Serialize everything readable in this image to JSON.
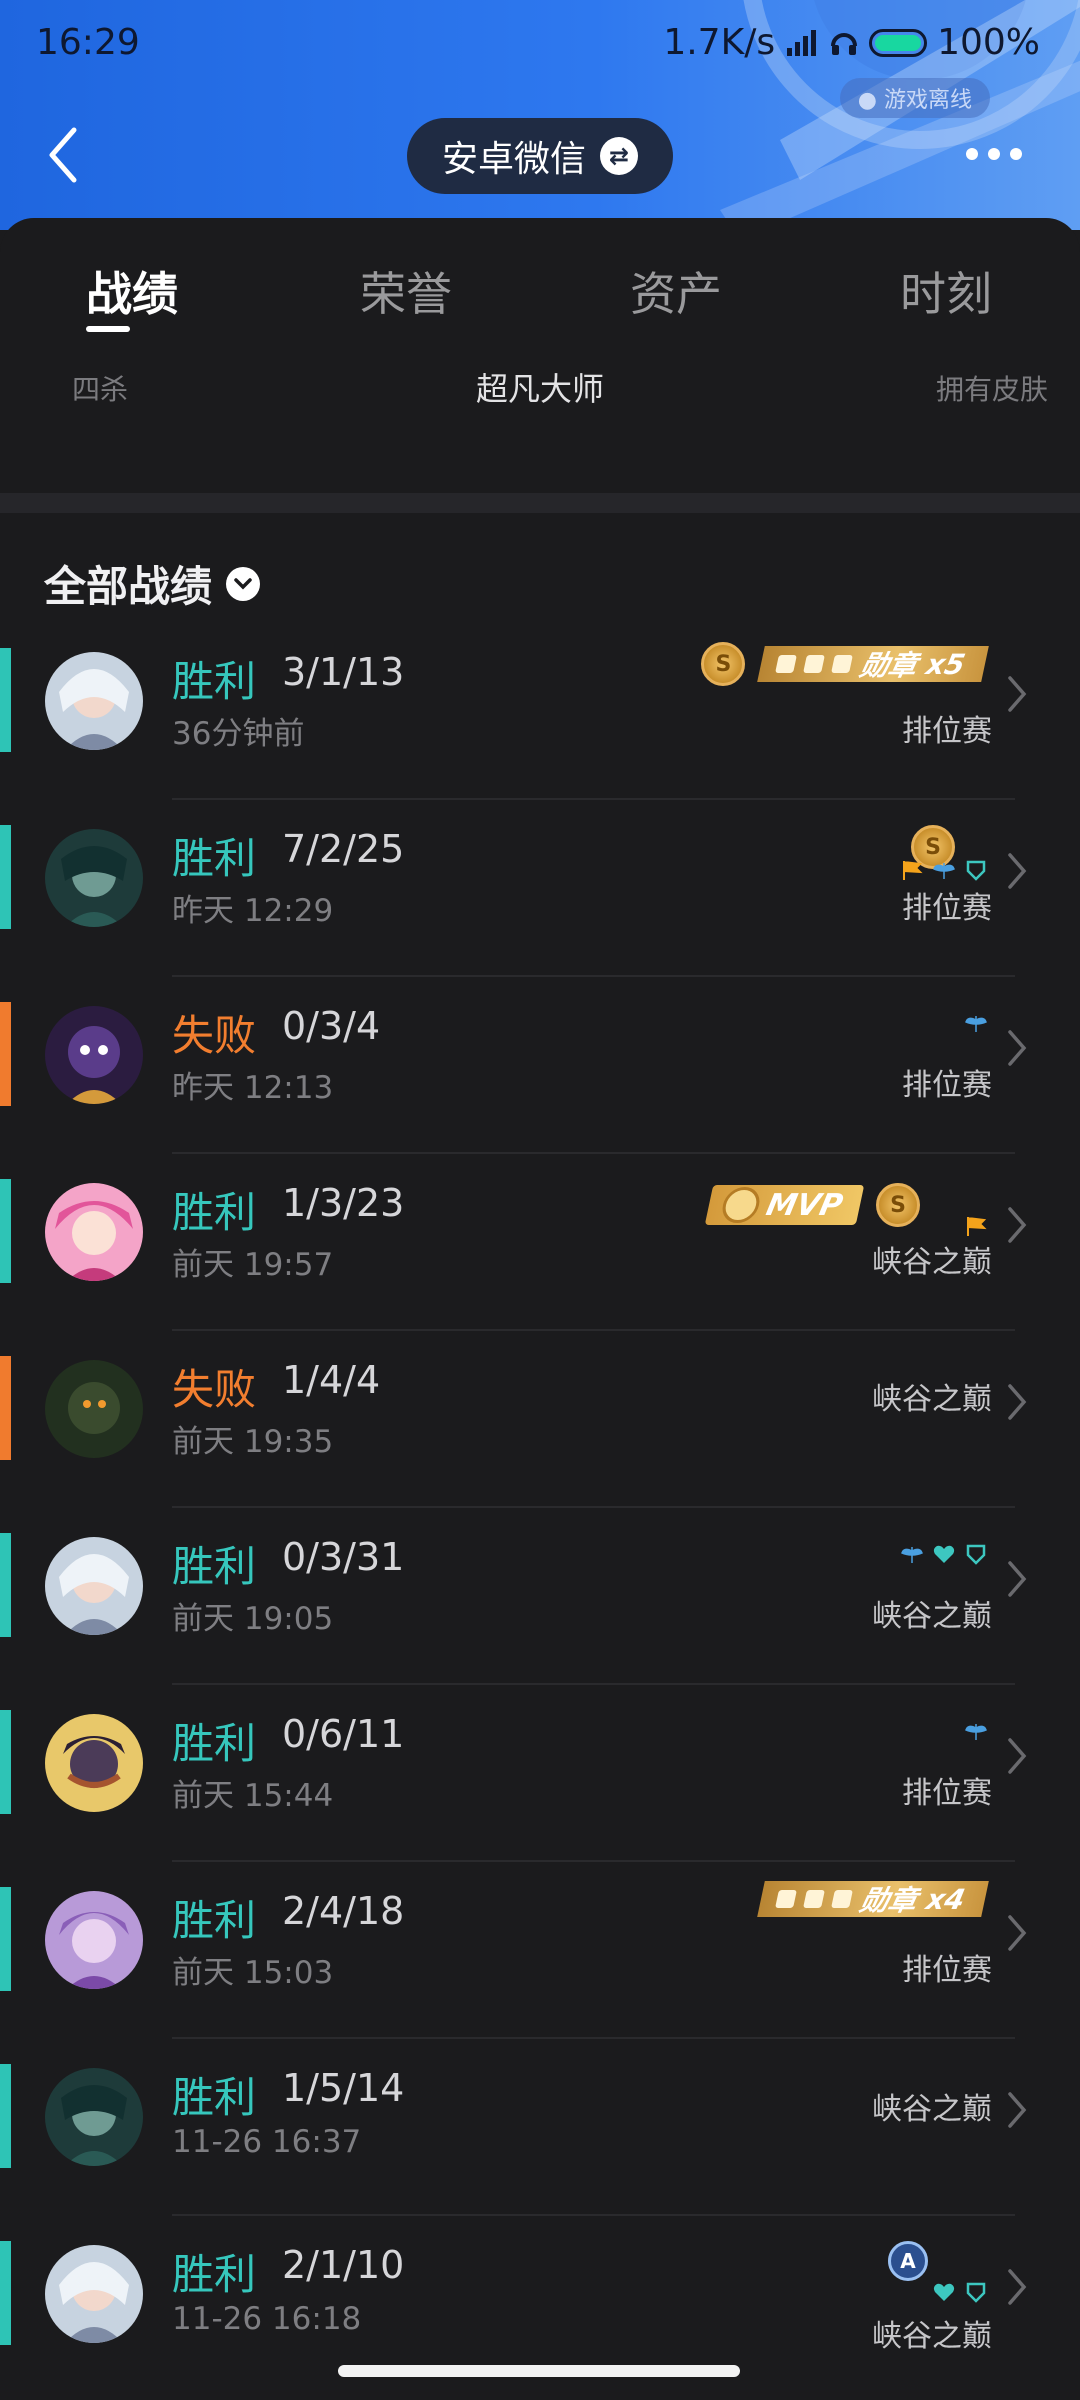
{
  "status_bar": {
    "time": "16:29",
    "network_speed": "1.7K/s",
    "battery": "100%"
  },
  "header": {
    "offline": "游戏离线",
    "account": "安卓微信"
  },
  "tabs": [
    "战绩",
    "荣誉",
    "资产",
    "时刻"
  ],
  "stats_row": {
    "left": "四杀",
    "middle": "超凡大师",
    "right": "拥有皮肤"
  },
  "filter": {
    "label": "全部战绩"
  },
  "medal_label": "勋章",
  "mvp_label": "MVP",
  "colors": {
    "win": "#36c7bd",
    "loss": "#f27e2f",
    "header_blue": "#2e78ef"
  },
  "matches": [
    {
      "result": "胜利",
      "kda": "3/1/13",
      "time": "36分钟前",
      "mode": "排位赛",
      "outcome": "win",
      "medal_count": "x5"
    },
    {
      "result": "胜利",
      "kda": "7/2/25",
      "time": "昨天 12:29",
      "mode": "排位赛",
      "outcome": "win"
    },
    {
      "result": "失败",
      "kda": "0/3/4",
      "time": "昨天 12:13",
      "mode": "排位赛",
      "outcome": "loss"
    },
    {
      "result": "胜利",
      "kda": "1/3/23",
      "time": "前天 19:57",
      "mode": "峡谷之巅",
      "outcome": "win"
    },
    {
      "result": "失败",
      "kda": "1/4/4",
      "time": "前天 19:35",
      "mode": "峡谷之巅",
      "outcome": "loss"
    },
    {
      "result": "胜利",
      "kda": "0/3/31",
      "time": "前天 19:05",
      "mode": "峡谷之巅",
      "outcome": "win"
    },
    {
      "result": "胜利",
      "kda": "0/6/11",
      "time": "前天 15:44",
      "mode": "排位赛",
      "outcome": "win"
    },
    {
      "result": "胜利",
      "kda": "2/4/18",
      "time": "前天 15:03",
      "mode": "排位赛",
      "outcome": "win",
      "medal_count": "x4"
    },
    {
      "result": "胜利",
      "kda": "1/5/14",
      "time": "11-26 16:37",
      "mode": "峡谷之巅",
      "outcome": "win"
    },
    {
      "result": "胜利",
      "kda": "2/1/10",
      "time": "11-26 16:18",
      "mode": "峡谷之巅",
      "outcome": "win"
    }
  ]
}
